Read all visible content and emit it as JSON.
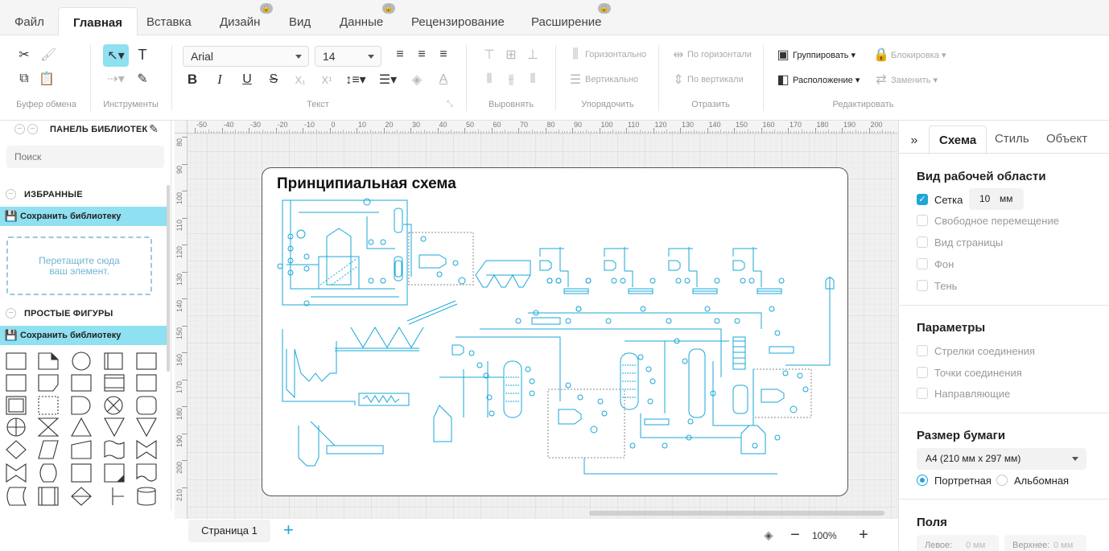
{
  "menu_tabs": [
    {
      "label": "Файл",
      "locked": false
    },
    {
      "label": "Главная",
      "locked": false,
      "active": true
    },
    {
      "label": "Вставка",
      "locked": false
    },
    {
      "label": "Дизайн",
      "locked": true
    },
    {
      "label": "Вид",
      "locked": false
    },
    {
      "label": "Данные",
      "locked": true
    },
    {
      "label": "Рецензирование",
      "locked": false
    },
    {
      "label": "Расширение",
      "locked": true
    }
  ],
  "ribbon": {
    "groups": {
      "clipboard": "Буфер обмена",
      "tools": "Инструменты",
      "text": "Текст",
      "align": "Выровнять",
      "arrange": "Упорядочить",
      "mirror": "Отразить",
      "edit": "Редактировать"
    },
    "font_family": "Arial",
    "font_size": "14",
    "arrange_horizontal": "Горизонтально",
    "arrange_vertical": "Вертикально",
    "mirror_horizontal": "По горизонтали",
    "mirror_vertical": "По вертикали",
    "group": "Группировать",
    "lock": "Блокировка",
    "position": "Расположение",
    "replace": "Заменить"
  },
  "library": {
    "panel_title": "ПАНЕЛЬ БИБЛИОТЕК",
    "search_placeholder": "Поиск",
    "favorites": "ИЗБРАННЫЕ",
    "save_library": "Сохранить библиотеку",
    "drop_hint": "Перетащите сюда ваш элемент.",
    "simple_shapes": "ПРОСТЫЕ ФИГУРЫ"
  },
  "ruler": {
    "h_ticks": [
      "-50",
      "-40",
      "-30",
      "-20",
      "-10",
      "0",
      "10",
      "20",
      "30",
      "40",
      "50",
      "60",
      "70",
      "80",
      "90",
      "100",
      "110",
      "120",
      "130",
      "140",
      "150",
      "160",
      "170",
      "180",
      "190",
      "200"
    ],
    "v_ticks": [
      "80",
      "90",
      "100",
      "110",
      "120",
      "130",
      "140",
      "150",
      "160",
      "170",
      "180",
      "190",
      "200",
      "210"
    ]
  },
  "diagram": {
    "title": "Принципиальная схема"
  },
  "bottom": {
    "page_tab": "Страница 1",
    "add_page": "+",
    "zoom": "100%"
  },
  "right_panel": {
    "tabs": [
      "Схема",
      "Стиль",
      "Объект"
    ],
    "workspace_title": "Вид рабочей области",
    "grid_label": "Сетка",
    "grid_value": "10",
    "grid_unit": "мм",
    "free_move": "Свободное перемещение",
    "page_view": "Вид страницы",
    "background": "Фон",
    "shadow": "Тень",
    "params_title": "Параметры",
    "conn_arrows": "Стрелки соединения",
    "conn_points": "Точки соединения",
    "guides": "Направляющие",
    "paper_title": "Размер бумаги",
    "paper_size": "A4 (210 мм x 297 мм)",
    "portrait": "Портретная",
    "landscape": "Альбомная",
    "margins_title": "Поля",
    "margin_left_label": "Левое:",
    "margin_left_value": "0 мм",
    "margin_top_label": "Верхнее:",
    "margin_top_value": "0 мм"
  },
  "colors": {
    "accent": "#1ea6d6",
    "schematic": "#1aa7d8",
    "library_save_bar": "#8fe0f0"
  }
}
